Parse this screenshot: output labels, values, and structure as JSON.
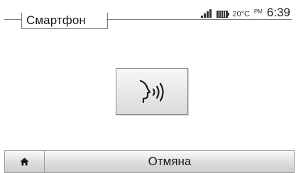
{
  "header": {
    "title": "Смартфон",
    "status": {
      "signal_icon": "signal-bars-icon",
      "battery_icon": "battery-icon",
      "temperature": "20°C",
      "ampm": "PM",
      "time": "6:39"
    }
  },
  "main": {
    "voice_button_icon": "voice-recognition-icon"
  },
  "bottom_bar": {
    "home_icon": "home-icon",
    "cancel_label": "Отмяна"
  },
  "colors": {
    "background": "#ffffff",
    "text": "#1b1b1b",
    "border": "#8a8a8a"
  }
}
